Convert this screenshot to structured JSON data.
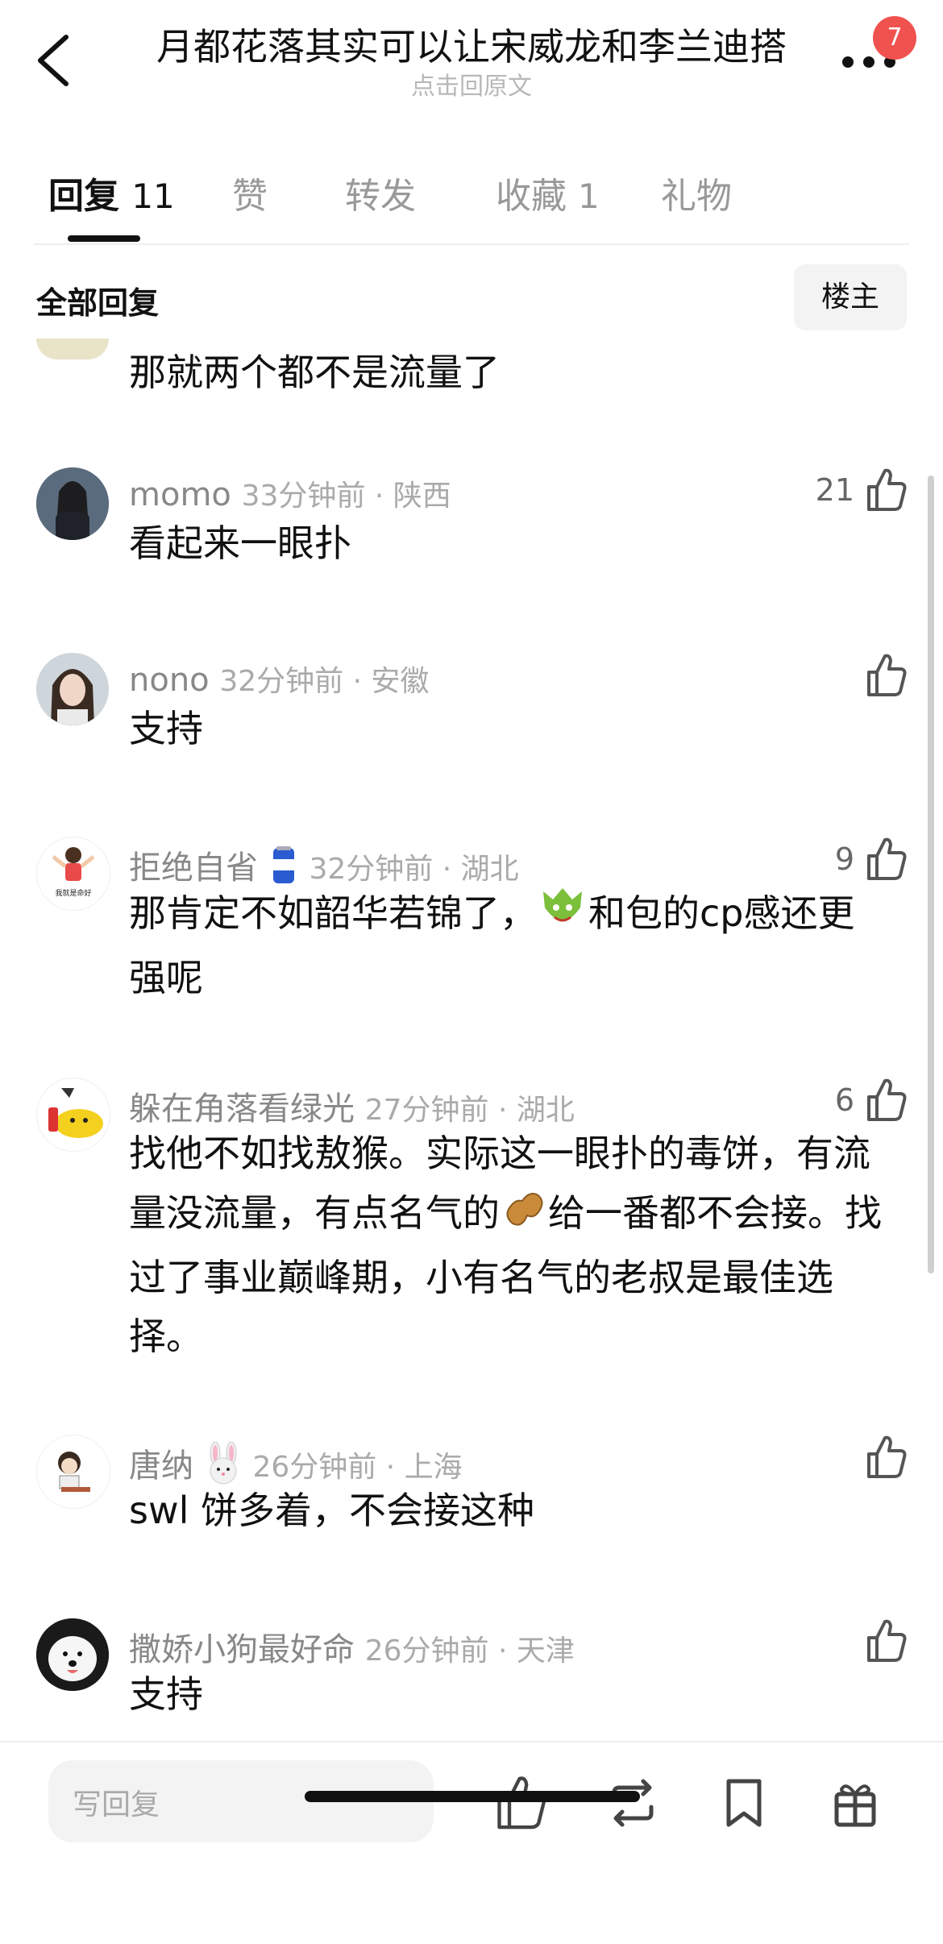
{
  "header": {
    "title": "月都花落其实可以让宋威龙和李兰迪搭",
    "subtitle": "点击回原文",
    "badge": "7"
  },
  "tabs": [
    {
      "label": "回复",
      "count": "11"
    },
    {
      "label": "赞",
      "count": ""
    },
    {
      "label": "转发",
      "count": ""
    },
    {
      "label": "收藏",
      "count": "1"
    },
    {
      "label": "礼物",
      "count": ""
    }
  ],
  "filter": {
    "all_replies": "全部回复",
    "owner_button": "楼主"
  },
  "comments": [
    {
      "username": "",
      "time": "",
      "location": "",
      "text": "那就两个都不是流量了",
      "likes": ""
    },
    {
      "username": "momo",
      "time": "33分钟前",
      "location": "陕西",
      "text": "看起来一眼扑",
      "likes": "21"
    },
    {
      "username": "nono",
      "time": "32分钟前",
      "location": "安徽",
      "text": "支持",
      "likes": ""
    },
    {
      "username": "拒绝自省",
      "time": "32分钟前",
      "location": "湖北",
      "text_a": "那肯定不如韶华若锦了，",
      "text_b": "和包的cp感还更强呢",
      "likes": "9"
    },
    {
      "username": "躲在角落看绿光",
      "time": "27分钟前",
      "location": "湖北",
      "text_a": "找他不如找敖猴。实际这一眼扑的毒饼，有流量没流量，有点名气的",
      "text_b": "给一番都不会接。找过了事业巅峰期，小有名气的老叔是最佳选择。",
      "likes": "6"
    },
    {
      "username": "唐纳",
      "time": "26分钟前",
      "location": "上海",
      "text": "swl 饼多着，不会接这种",
      "likes": ""
    },
    {
      "username": "撒娇小狗最好命",
      "time": "26分钟前",
      "location": "天津",
      "text": "支持",
      "likes": ""
    }
  ],
  "avatar_text": "我就是命好",
  "bottom_bar": {
    "reply_placeholder": "写回复",
    "icons": [
      "like-icon",
      "repost-icon",
      "bookmark-icon",
      "gift-icon"
    ]
  },
  "colors": {
    "accent_badge": "#f0524f",
    "secondary_text": "#888888",
    "divider": "#eeeeee"
  }
}
